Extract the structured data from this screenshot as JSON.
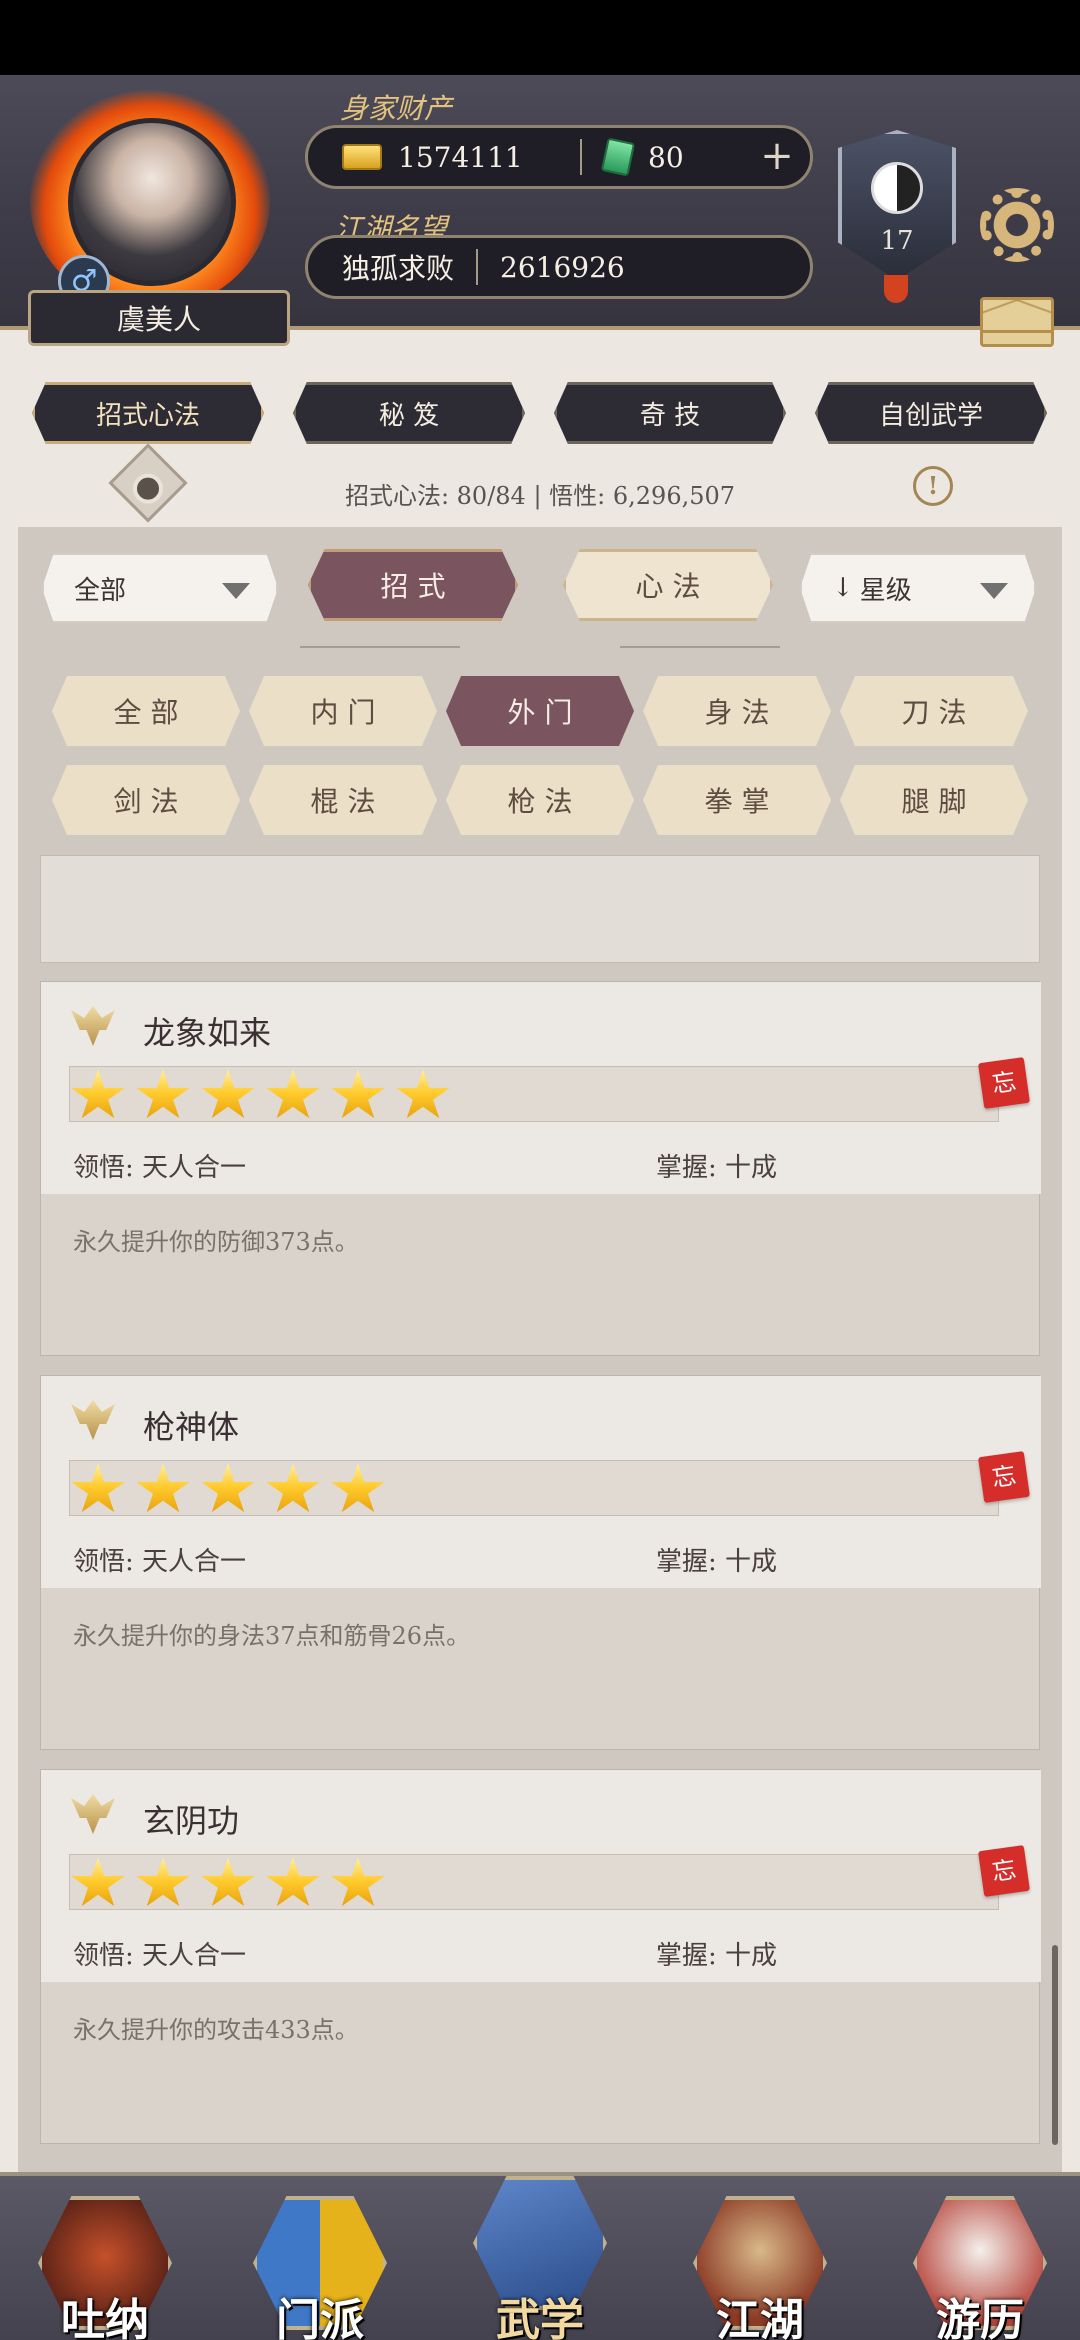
{
  "player": {
    "name": "虞美人",
    "gender_icon": "♂",
    "wealth_label": "身家财产",
    "gold": "1574111",
    "jade": "80",
    "plus": "+",
    "reputation_label": "江湖名望",
    "title": "独孤求败",
    "reputation": "2616926",
    "rank": "17"
  },
  "tabs": [
    "招式心法",
    "秘 笈",
    "奇 技",
    "自创武学"
  ],
  "active_tab": 0,
  "stats": {
    "line": "招式心法: 80/84  |  悟性: 6,296,507",
    "info_icon": "!"
  },
  "filters": {
    "scope": "全部",
    "type_moves": "招 式",
    "type_mind": "心 法",
    "sort": "星级",
    "sort_arrow": "↓"
  },
  "categories": [
    "全 部",
    "内 门",
    "外 门",
    "身 法",
    "刀 法",
    "剑 法",
    "棍 法",
    "枪 法",
    "拳 掌",
    "腿 脚"
  ],
  "active_category": 2,
  "skills": [
    {
      "name": "龙象如来",
      "stars": 6,
      "comprehension": "领悟:  天人合一",
      "mastery": "掌握:  十成",
      "desc": "永久提升你的防御373点。",
      "forget": "忘"
    },
    {
      "name": "枪神体",
      "stars": 5,
      "comprehension": "领悟:  天人合一",
      "mastery": "掌握:  十成",
      "desc": "永久提升你的身法37点和筋骨26点。",
      "forget": "忘"
    },
    {
      "name": "玄阴功",
      "stars": 5,
      "comprehension": "领悟:  天人合一",
      "mastery": "掌握:  十成",
      "desc": "永久提升你的攻击433点。",
      "forget": "忘"
    }
  ],
  "nav": [
    "吐纳",
    "门派",
    "武学",
    "江湖",
    "游历"
  ],
  "active_nav": 2,
  "colors": {
    "accent": "#7a5560",
    "gold": "#e2c27e",
    "star": "#ffca2c",
    "forget": "#d42d2a"
  }
}
